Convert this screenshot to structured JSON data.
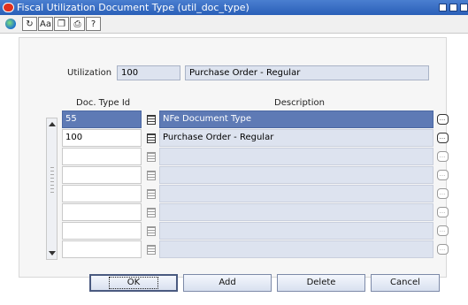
{
  "window": {
    "title": "Fiscal Utilization Document Type (util_doc_type)"
  },
  "toolbar": {
    "items": [
      {
        "icon": "globe-icon"
      },
      {
        "icon": "refresh-icon",
        "glyph": "↻"
      },
      {
        "icon": "text-size-icon",
        "glyph": "Aa"
      },
      {
        "icon": "copy-icon",
        "glyph": "❐"
      },
      {
        "icon": "print-icon",
        "glyph": "⎙"
      },
      {
        "icon": "help-icon",
        "glyph": "?"
      }
    ]
  },
  "form": {
    "utilization_label": "Utilization",
    "utilization_id": "100",
    "utilization_desc": "Purchase Order - Regular"
  },
  "grid": {
    "col_id_header": "Doc. Type Id",
    "col_desc_header": "Description",
    "rows": [
      {
        "id": "55",
        "desc": "NFe Document Type",
        "selected": true
      },
      {
        "id": "100",
        "desc": "Purchase Order - Regular",
        "selected": false
      },
      {
        "id": "",
        "desc": "",
        "selected": false
      },
      {
        "id": "",
        "desc": "",
        "selected": false
      },
      {
        "id": "",
        "desc": "",
        "selected": false
      },
      {
        "id": "",
        "desc": "",
        "selected": false
      },
      {
        "id": "",
        "desc": "",
        "selected": false
      },
      {
        "id": "",
        "desc": "",
        "selected": false
      }
    ]
  },
  "buttons": {
    "ok": "OK",
    "add": "Add",
    "delete": "Delete",
    "cancel": "Cancel"
  }
}
